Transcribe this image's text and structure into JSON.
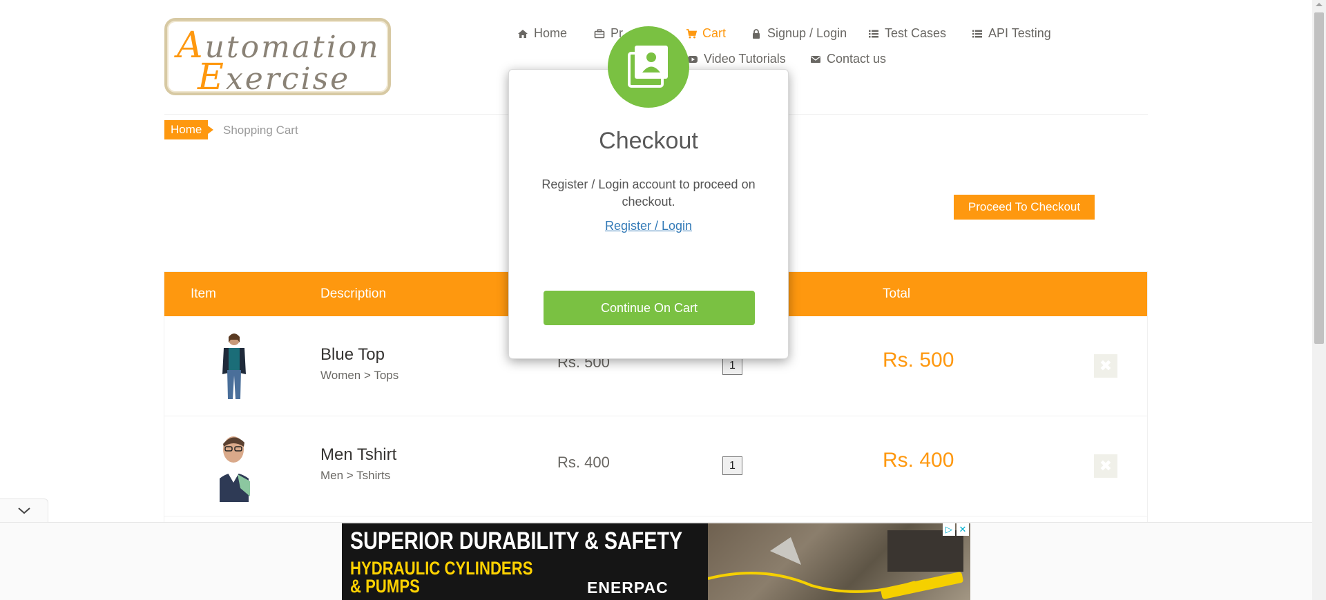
{
  "logo": {
    "line1_cap": "A",
    "line1_rest": "utomation",
    "line2_cap": "E",
    "line2_rest": "xercise"
  },
  "nav": {
    "home": "Home",
    "products": "Pr",
    "cart": "Cart",
    "signup_login": "Signup / Login",
    "test_cases": "Test Cases",
    "api_testing": "API Testing",
    "video_tutorials": "Video Tutorials",
    "contact_us": "Contact us"
  },
  "breadcrumb": {
    "home": "Home",
    "current": "Shopping Cart"
  },
  "proceed_button": "Proceed To Checkout",
  "table": {
    "headers": {
      "item": "Item",
      "description": "Description",
      "total": "Total"
    },
    "rows": [
      {
        "name": "Blue Top",
        "category": "Women > Tops",
        "price": "Rs. 500",
        "quantity": "1",
        "total": "Rs. 500",
        "delete": "✖"
      },
      {
        "name": "Men Tshirt",
        "category": "Men > Tshirts",
        "price": "Rs. 400",
        "quantity": "1",
        "total": "Rs. 400",
        "delete": "✖"
      }
    ]
  },
  "modal": {
    "title": "Checkout",
    "text": "Register / Login account to proceed on checkout.",
    "link": "Register / Login",
    "continue_button": "Continue On Cart"
  },
  "ad": {
    "headline": "SUPERIOR DURABILITY & SAFETY",
    "sub1": "HYDRAULIC CYLINDERS",
    "sub2": "& PUMPS",
    "brand": "ENERPAC"
  },
  "colors": {
    "accent": "#fe980f",
    "success": "#7ac142",
    "link": "#337ab7"
  }
}
